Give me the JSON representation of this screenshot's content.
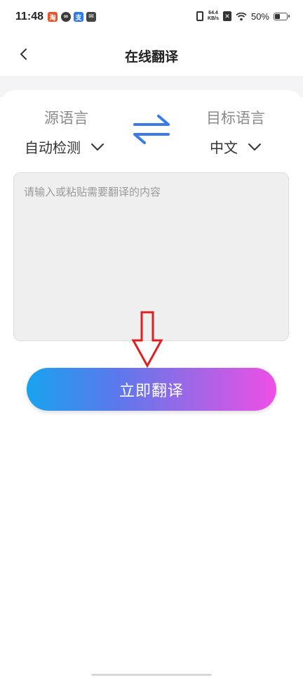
{
  "status_bar": {
    "time": "11:48",
    "network_speed_value": "64.4",
    "network_speed_unit": "KB/s",
    "battery_percent": "50%",
    "notification_icons": [
      "shopping-app-icon",
      "link-app-icon",
      "alipay-icon",
      "message-app-icon"
    ]
  },
  "header": {
    "title": "在线翻译"
  },
  "languages": {
    "source_label": "源语言",
    "source_value": "自动检测",
    "target_label": "目标语言",
    "target_value": "中文"
  },
  "input": {
    "placeholder": "请输入或粘贴需要翻译的内容",
    "value": ""
  },
  "actions": {
    "translate_label": "立即翻译"
  },
  "colors": {
    "accent_blue": "#3d7be8",
    "button_gradient_start": "#19a3ef",
    "button_gradient_end": "#ef4fe5",
    "annotation_arrow": "#e02020"
  }
}
